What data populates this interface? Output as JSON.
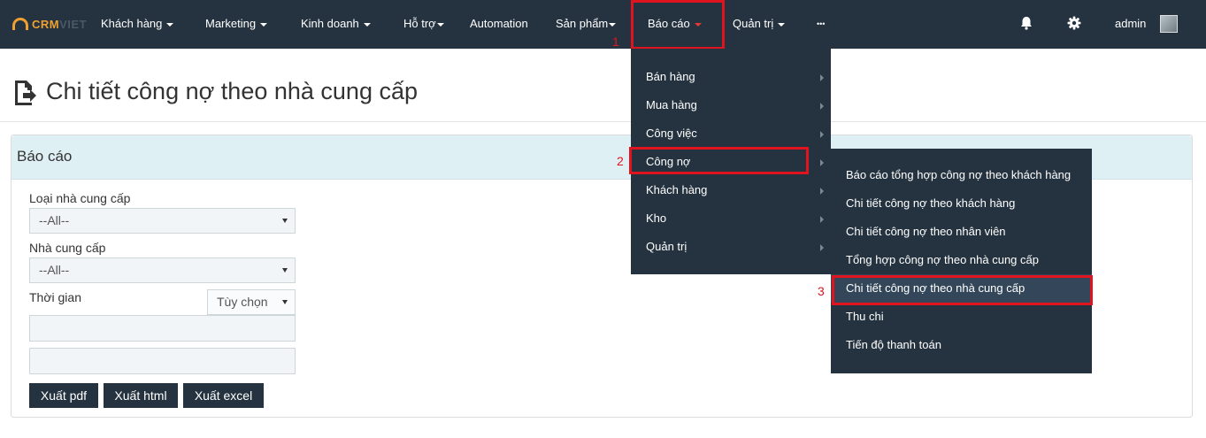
{
  "logo": {
    "part1": "CRM",
    "part2": "VIET"
  },
  "nav": {
    "items": [
      "Khách hàng",
      "Marketing",
      "Kinh doanh",
      "Hỗ trợ",
      "Automation",
      "Sản phẩm",
      "Báo cáo",
      "Quản trị",
      "•••"
    ],
    "user": "admin"
  },
  "annotations": [
    "1",
    "2",
    "3"
  ],
  "page": {
    "title": "Chi tiết công nợ theo nhà cung cấp"
  },
  "panel": {
    "title": "Báo cáo",
    "supplier_type_label": "Loại nhà cung cấp",
    "supplier_type_value": "--All--",
    "supplier_label": "Nhà cung cấp",
    "supplier_value": "--All--",
    "time_label": "Thời gian",
    "time_option": "Tùy chọn",
    "buttons": [
      "Xuất pdf",
      "Xuất html",
      "Xuất excel"
    ]
  },
  "report_menu": {
    "items": [
      "Bán hàng",
      "Mua hàng",
      "Công việc",
      "Công nợ",
      "Khách hàng",
      "Kho",
      "Quản trị"
    ]
  },
  "debt_submenu": {
    "items": [
      "Báo cáo tổng hợp công nợ theo khách hàng",
      "Chi tiết công nợ theo khách hàng",
      "Chi tiết công nợ theo nhân viên",
      "Tổng hợp công nợ theo nhà cung cấp",
      "Chi tiết công nợ theo nhà cung cấp",
      "Thu chi",
      "Tiến độ thanh toán"
    ],
    "active_index": 4
  },
  "colors": {
    "navbar": "#253340",
    "highlight": "#e0141e",
    "panel_head": "#dff0f5",
    "logo_accent": "#f0a030"
  },
  "icons": [
    "bell-icon",
    "gear-icon",
    "avatar",
    "document-export-icon"
  ]
}
